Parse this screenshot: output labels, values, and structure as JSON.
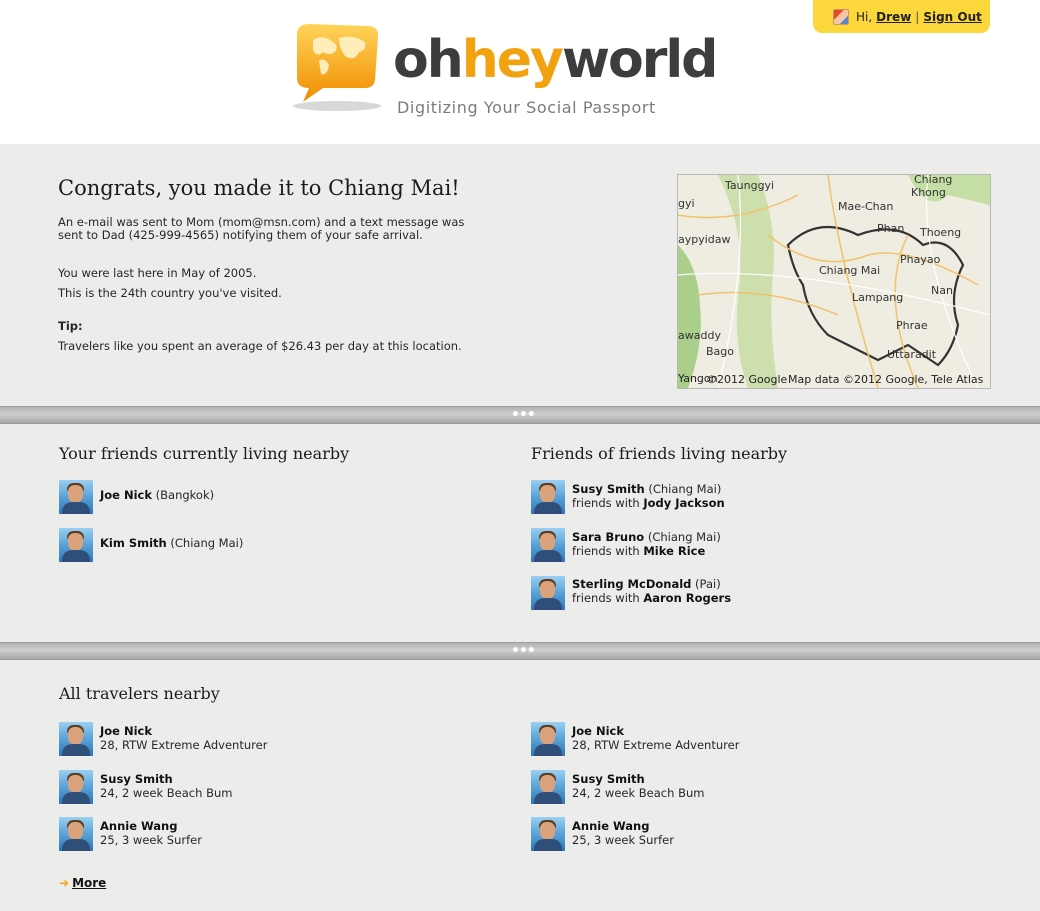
{
  "header": {
    "brand": {
      "part1": "oh",
      "part2": "hey",
      "part3": "world"
    },
    "tagline": "Digitizing Your Social Passport",
    "user": {
      "greeting": "Hi,",
      "name": "Drew",
      "separator": "|",
      "sign_out": "Sign Out"
    }
  },
  "arrival": {
    "title": "Congrats, you made it to Chiang Mai!",
    "notify_line1": "An e-mail was sent to Mom (mom@msn.com) and a text message was",
    "notify_line2": "sent to Dad (425-999-4565) notifying them of your safe arrival.",
    "last_here": "You were last here in May of 2005.",
    "country_count": "This is the 24th country you've visited.",
    "tip_label": "Tip:",
    "tip_text": "Travelers like you spent an average of $26.43 per day at this location."
  },
  "map": {
    "labels": [
      "Taunggyi",
      "Chiang",
      "Khong",
      "Mae-Chan",
      "gyi",
      "aypyidaw",
      "Phan",
      "Thoeng",
      "Chiang Mai",
      "Phayao",
      "Lampang",
      "Nan",
      "Phrae",
      "awaddy",
      "Uttaradit",
      "Bago",
      "Yangon"
    ],
    "attribution_left": "©2012 Google",
    "attribution_right": "Map data ©2012 Google, Tele Atlas"
  },
  "friends_nearby": {
    "title": "Your friends currently living nearby",
    "items": [
      {
        "name": "Joe Nick",
        "location": "(Bangkok)"
      },
      {
        "name": "Kim Smith",
        "location": "(Chiang Mai)"
      }
    ]
  },
  "friends_of_friends": {
    "title": "Friends of friends living nearby",
    "friends_with_label": "friends with",
    "items": [
      {
        "name": "Susy Smith",
        "location": "(Chiang Mai)",
        "friend": "Jody Jackson"
      },
      {
        "name": "Sara Bruno",
        "location": "(Chiang Mai)",
        "friend": "Mike Rice"
      },
      {
        "name": "Sterling McDonald",
        "location": "(Pai)",
        "friend": "Aaron Rogers"
      }
    ]
  },
  "all_travelers": {
    "title": "All travelers nearby",
    "left": [
      {
        "name": "Joe Nick",
        "desc": "28, RTW Extreme Adventurer"
      },
      {
        "name": "Susy Smith",
        "desc": "24, 2 week Beach Bum"
      },
      {
        "name": "Annie Wang",
        "desc": "25, 3 week Surfer"
      }
    ],
    "right": [
      {
        "name": "Joe Nick",
        "desc": "28, RTW Extreme Adventurer"
      },
      {
        "name": "Susy Smith",
        "desc": "24, 2 week Beach Bum"
      },
      {
        "name": "Annie Wang",
        "desc": "25, 3 week Surfer"
      }
    ],
    "more_label": "More"
  },
  "colors": {
    "accent": "#f2a10f",
    "userbar": "#fcd73b",
    "background": "#ececea"
  }
}
